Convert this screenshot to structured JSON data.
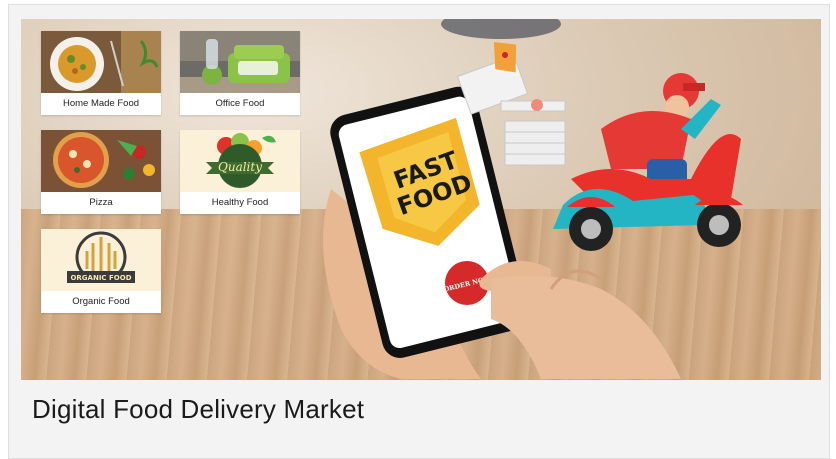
{
  "caption": "Digital Food Delivery Market",
  "tiles": [
    {
      "label": "Home Made Food",
      "icon": "home-made-food-icon"
    },
    {
      "label": "Office Food",
      "icon": "lunchbox-icon"
    },
    {
      "label": "Pizza",
      "icon": "pizza-icon"
    },
    {
      "label": "Healthy Food",
      "icon": "quality-fruit-badge-icon"
    },
    {
      "label": "Organic Food",
      "icon": "organic-wheat-badge-icon"
    }
  ],
  "phone": {
    "logo_line1": "FAST",
    "logo_line2": "FOOD",
    "order_button": "ORDER NOW"
  },
  "colors": {
    "fast_food_yellow": "#f3b52c",
    "order_red": "#d62a2a",
    "scooter_red": "#e8312a",
    "scooter_teal": "#24b5c4"
  }
}
